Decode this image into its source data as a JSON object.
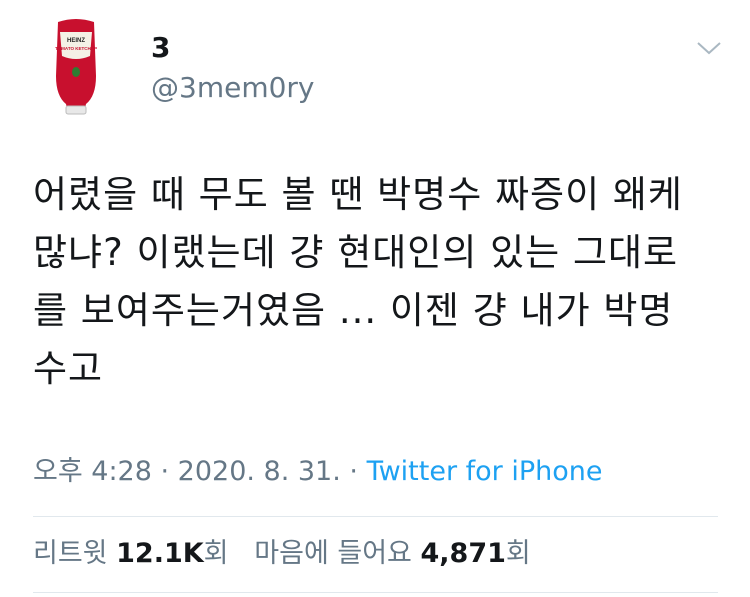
{
  "author": {
    "display_name": "3",
    "handle": "@3mem0ry",
    "avatar_icon": "ketchup-bottle-icon",
    "avatar_label_top": "HEINZ",
    "avatar_label_bottom": "TOMATO KETCHUP"
  },
  "menu_icon": "chevron-down-icon",
  "tweet": {
    "lines": [
      "어렸을 때 무도 볼 땐 박명수 짜증이 왜케",
      "많냐? 이랬는데 걍 현대인의 있는 그대로",
      "를 보여주는거였음 ... 이젠 걍 내가 박명",
      "수고"
    ]
  },
  "meta": {
    "time": "오후 4:28",
    "separator1": " · ",
    "date": "2020. 8. 31.",
    "separator2": " · ",
    "source": "Twitter for iPhone"
  },
  "stats": {
    "retweets_label": "리트윗",
    "retweets_count": "12.1K",
    "retweets_suffix": "회",
    "likes_label": "마음에 들어요",
    "likes_count": "4,871",
    "likes_suffix": "회"
  },
  "colors": {
    "text": "#14171a",
    "secondary": "#657786",
    "link": "#1da1f2",
    "ketchup_red": "#c8102e"
  }
}
